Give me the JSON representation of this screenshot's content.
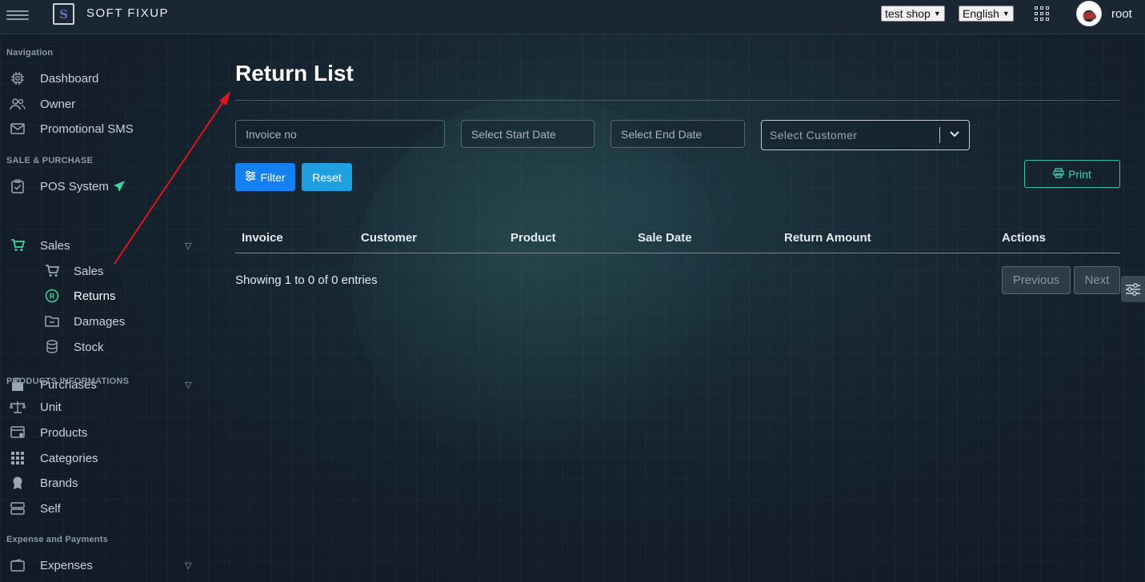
{
  "app": {
    "brand": "SOFT FIXUP",
    "logo_letter": "S"
  },
  "topbar": {
    "shop_select": "test shop",
    "language_select": "English",
    "user_name": "root"
  },
  "sidebar": {
    "sections": {
      "navigation": "Navigation",
      "sale_purchase": "SALE & PURCHASE",
      "products_info": "PRODUCTS INFORMATIONS",
      "expense_payments": "Expense and Payments"
    },
    "items": {
      "dashboard": "Dashboard",
      "owner": "Owner",
      "promo_sms": "Promotional SMS",
      "pos": "POS System",
      "sales": "Sales",
      "sales_sub": "Sales",
      "returns": "Returns",
      "damages": "Damages",
      "stock": "Stock",
      "purchases": "Purchases",
      "unit": "Unit",
      "products": "Products",
      "categories": "Categories",
      "brands": "Brands",
      "self": "Self",
      "expenses": "Expenses"
    }
  },
  "main": {
    "title": "Return List",
    "filters": {
      "invoice_placeholder": "Invoice no",
      "start_date_placeholder": "Select Start Date",
      "end_date_placeholder": "Select End Date",
      "customer_placeholder": "Select Customer"
    },
    "buttons": {
      "filter": "Filter",
      "reset": "Reset",
      "print": "Print"
    },
    "table": {
      "columns": [
        "Invoice",
        "Customer",
        "Product",
        "Sale Date",
        "Return Amount",
        "Actions"
      ],
      "rows": []
    },
    "info": "Showing 1 to 0 of 0 entries",
    "pagination": {
      "previous": "Previous",
      "next": "Next"
    }
  },
  "colors": {
    "primary": "#1580f2",
    "info": "#1fa0e0",
    "success_outline": "#34c7a1",
    "annotation_arrow": "#e0141e"
  }
}
